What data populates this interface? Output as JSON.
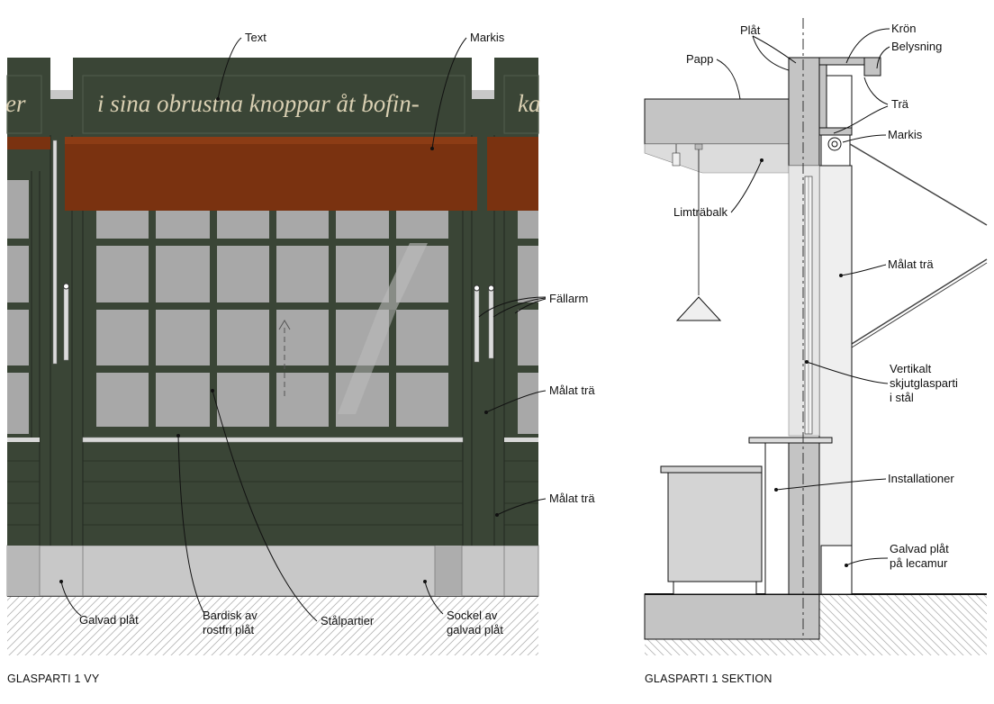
{
  "view": {
    "caption": "GLASPARTI 1 VY",
    "sign_text_main": "i sina obrustna knoppar åt bofin-",
    "sign_text_left": "er",
    "sign_text_right": "ka",
    "labels": {
      "text": "Text",
      "markis": "Markis",
      "fallarm": "Fällarm",
      "malat_tra_1": "Målat trä",
      "malat_tra_2": "Målat trä",
      "galvad_plat": "Galvad plåt",
      "bardisk_1": "Bardisk av",
      "bardisk_2": "rostfri plåt",
      "stalpartier": "Stålpartier",
      "sockel_1": "Sockel av",
      "sockel_2": "galvad plåt"
    }
  },
  "section": {
    "caption": "GLASPARTI 1 SEKTION",
    "labels": {
      "plat": "Plåt",
      "kron": "Krön",
      "belysning": "Belysning",
      "papp": "Papp",
      "tra": "Trä",
      "markis": "Markis",
      "limtrabalk": "Limträbalk",
      "malat_tra": "Målat trä",
      "vertikalt_1": "Vertikalt",
      "vertikalt_2": "skjutglasparti",
      "vertikalt_3": "i stål",
      "installationer": "Installationer",
      "galvad_1": "Galvad plåt",
      "galvad_2": "på lecamur"
    }
  },
  "colors": {
    "facade_green": "#3a4536",
    "awning_rust": "#7a3210",
    "glass_grey": "#a8a8a8",
    "plinth_grey": "#c4c4c4"
  }
}
